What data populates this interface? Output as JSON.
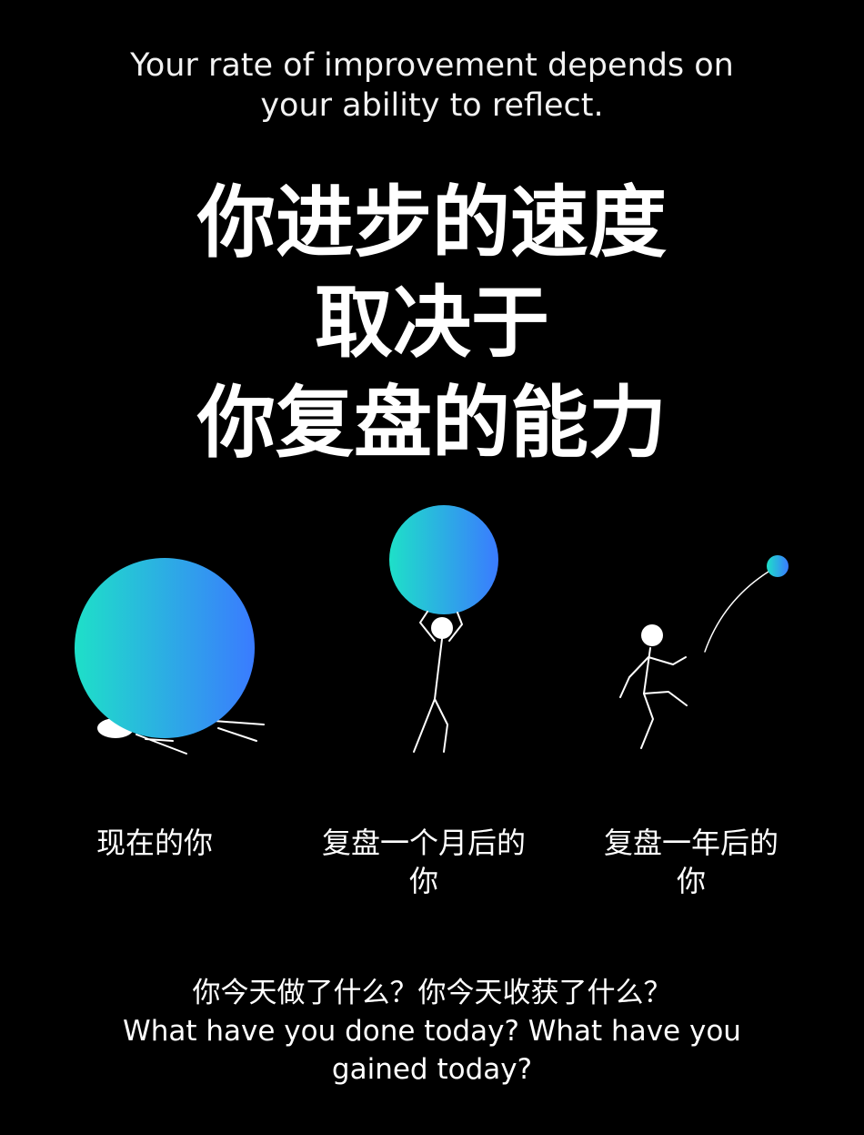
{
  "header": {
    "english_line_1": "Your rate of improvement depends on",
    "english_line_2": "your ability to reflect."
  },
  "title": {
    "line_1": "你进步的速度",
    "line_2": "取决于",
    "line_3": "你复盘的能力"
  },
  "illustrations": {
    "ball_gradient_start": "#1ee0c8",
    "ball_gradient_end": "#3a7bff",
    "figure_color": "#ffffff"
  },
  "captions": {
    "now": "现在的你",
    "one_month_line_1": "复盘一个月后的",
    "one_month_line_2": "你",
    "one_year_line_1": "复盘一年后的",
    "one_year_line_2": "你"
  },
  "footer": {
    "line_1": "你今天做了什么？你今天收获了什么？",
    "line_2": "What have you done today? What have you",
    "line_3": "gained today?"
  },
  "colors": {
    "background": "#000000",
    "text": "#ffffff"
  }
}
